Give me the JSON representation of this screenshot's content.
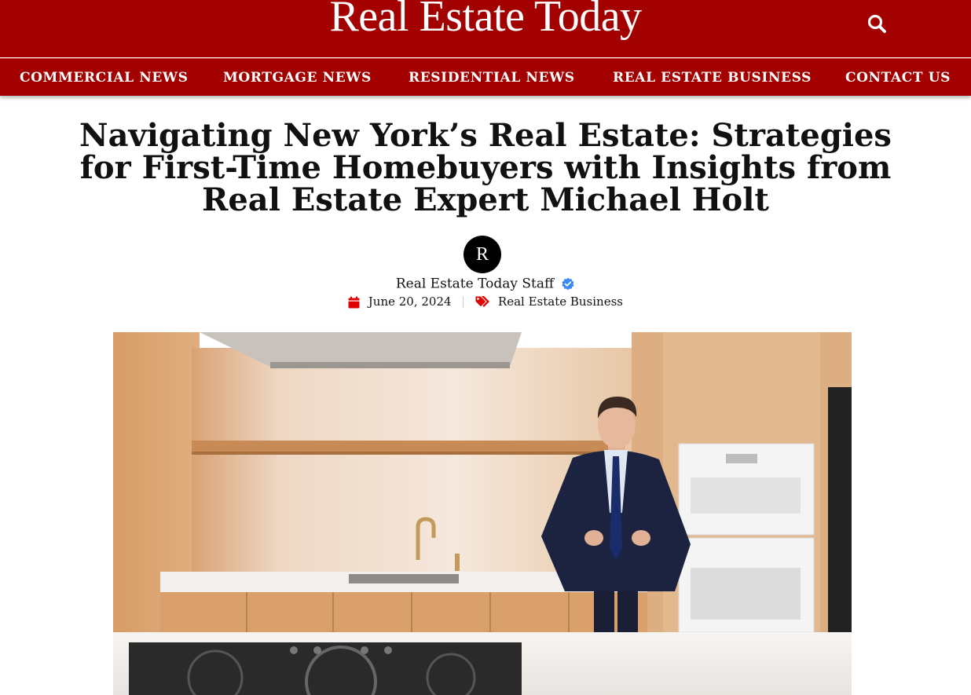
{
  "site": {
    "logo": "Real Estate Today"
  },
  "header": {
    "search_icon": "search-icon"
  },
  "nav": {
    "items": [
      {
        "label": "COMMERCIAL NEWS"
      },
      {
        "label": "MORTGAGE NEWS"
      },
      {
        "label": "RESIDENTIAL NEWS"
      },
      {
        "label": "REAL ESTATE BUSINESS"
      },
      {
        "label": "CONTACT US"
      }
    ]
  },
  "article": {
    "title": "Navigating New York’s Real Estate: Strategies for First-Time Homebuyers with Insights from Real Estate Expert Michael Holt",
    "avatar_letter": "R",
    "author": "Real Estate Today Staff",
    "verified_icon": "verified-badge-icon",
    "date": "June 20, 2024",
    "date_icon": "calendar-icon",
    "category": "Real Estate Business",
    "category_icon": "tags-icon",
    "hero_image": "man-in-suit-in-kitchen-photo"
  },
  "colors": {
    "brand_red": "#a30000",
    "icon_red": "#e00000",
    "verified_blue": "#3d8af7"
  }
}
